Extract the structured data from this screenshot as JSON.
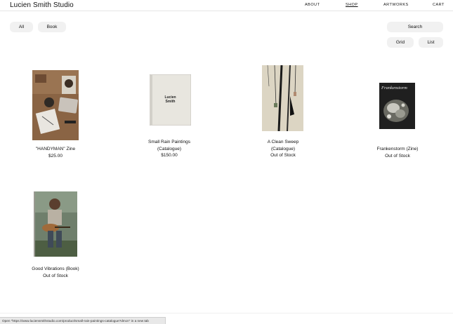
{
  "header": {
    "site_title": "Lucien Smith Studio",
    "nav": [
      "ABOUT",
      "SHOP",
      "ARTWORKS",
      "CART"
    ],
    "active_nav": "SHOP"
  },
  "filters": {
    "all_label": "All",
    "book_label": "Book"
  },
  "controls": {
    "search_label": "Search",
    "grid_label": "Grid",
    "list_label": "List"
  },
  "products": [
    {
      "title": "\"HANDYMAN\" Zine",
      "title2": "",
      "status": "$25.00"
    },
    {
      "title": "Small Rain Paintings",
      "title2": "(Catalogue)",
      "status": "$150.00",
      "cover_text": "Lucien Smith"
    },
    {
      "title": "A Clean Sweep",
      "title2": "(Catalogue)",
      "status": "Out of Stock"
    },
    {
      "title": "Frankenstorm (Zine)",
      "title2": "",
      "status": "Out of Stock",
      "cover_text": "Frankenstorm"
    },
    {
      "title": "Good Vibrations (Book)",
      "title2": "",
      "status": "Out of Stock"
    }
  ],
  "status_bar": "Open \"https://www.luciensmithstudio.com/product/small-rain-paintings-catalogue?dmcn\" in a new tab"
}
